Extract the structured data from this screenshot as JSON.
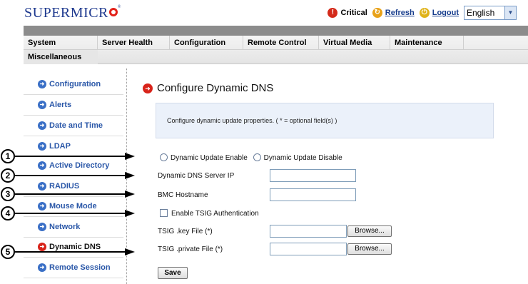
{
  "header": {
    "logo_text": "SUPERMICR",
    "logo_reg": "®",
    "critical_label": "Critical",
    "refresh_label": "Refresh",
    "logout_label": "Logout",
    "language_value": "English"
  },
  "nav": {
    "system": "System",
    "server_health": "Server Health",
    "configuration": "Configuration",
    "remote_control": "Remote Control",
    "virtual_media": "Virtual Media",
    "maintenance": "Maintenance",
    "miscellaneous": "Miscellaneous"
  },
  "sidebar": {
    "items": [
      {
        "label": "Configuration"
      },
      {
        "label": "Alerts"
      },
      {
        "label": "Date and Time"
      },
      {
        "label": "LDAP"
      },
      {
        "label": "Active Directory"
      },
      {
        "label": "RADIUS"
      },
      {
        "label": "Mouse Mode"
      },
      {
        "label": "Network"
      },
      {
        "label": "Dynamic DNS"
      },
      {
        "label": "Remote Session"
      }
    ]
  },
  "main": {
    "title": "Configure Dynamic DNS",
    "info_text": "Configure dynamic update properties. ( * = optional field(s) )",
    "radio_enable_label": "Dynamic Update Enable",
    "radio_disable_label": "Dynamic Update Disable",
    "server_ip_label": "Dynamic DNS Server IP",
    "server_ip_value": "",
    "hostname_label": "BMC Hostname",
    "hostname_value": "",
    "tsig_label": "Enable TSIG Authentication",
    "tsig_key_label": "TSIG .key File (*)",
    "tsig_private_label": "TSIG .private File (*)",
    "browse_label": "Browse...",
    "save_label": "Save"
  },
  "callouts": [
    "1",
    "2",
    "3",
    "4",
    "5"
  ]
}
